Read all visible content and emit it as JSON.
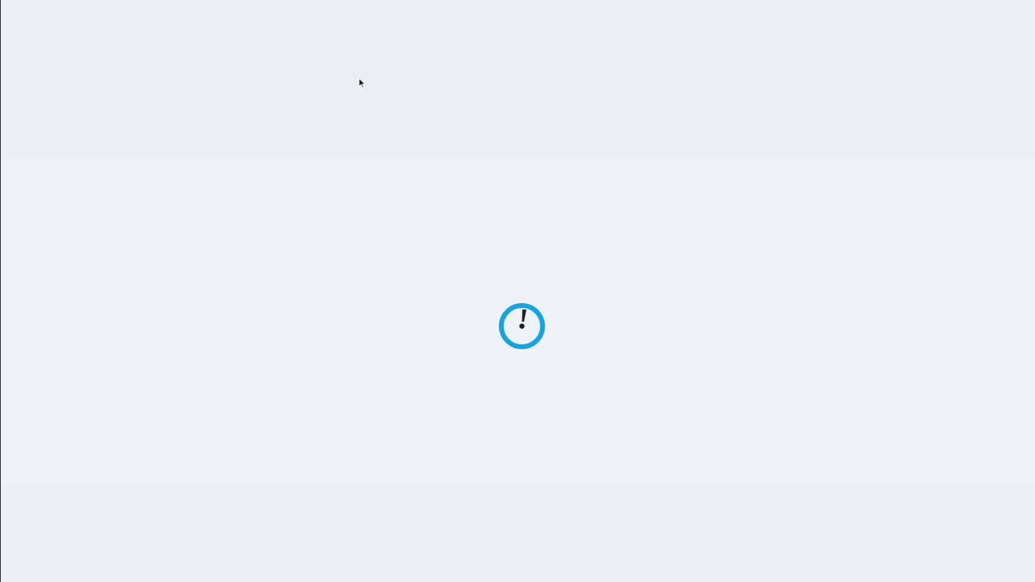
{
  "page": {
    "state": "loading"
  },
  "loader": {
    "icon": "loading-alert-icon",
    "ring_color": "#18a3de",
    "mark_color": "#222222"
  },
  "cursor": {
    "icon": "mouse-pointer-icon"
  }
}
